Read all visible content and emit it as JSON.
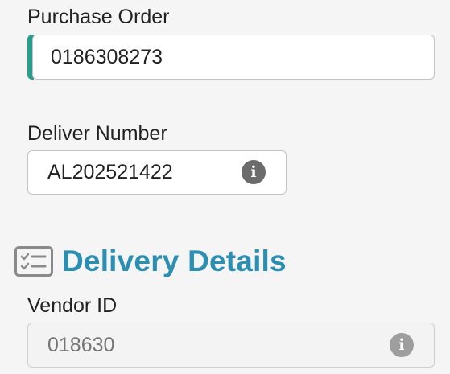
{
  "purchase_order": {
    "label": "Purchase Order",
    "value": "0186308273"
  },
  "deliver_number": {
    "label": "Deliver Number",
    "value": "AL202521422",
    "info_icon": "info-icon"
  },
  "delivery_details": {
    "title": "Delivery Details",
    "icon": "checklist-icon"
  },
  "vendor_id": {
    "label": "Vendor ID",
    "value": "018630",
    "info_icon": "info-icon"
  },
  "colors": {
    "accent_teal": "#2a9d8f",
    "section_title_blue": "#2b8eb3",
    "info_icon_gray": "#6b6b6b"
  }
}
